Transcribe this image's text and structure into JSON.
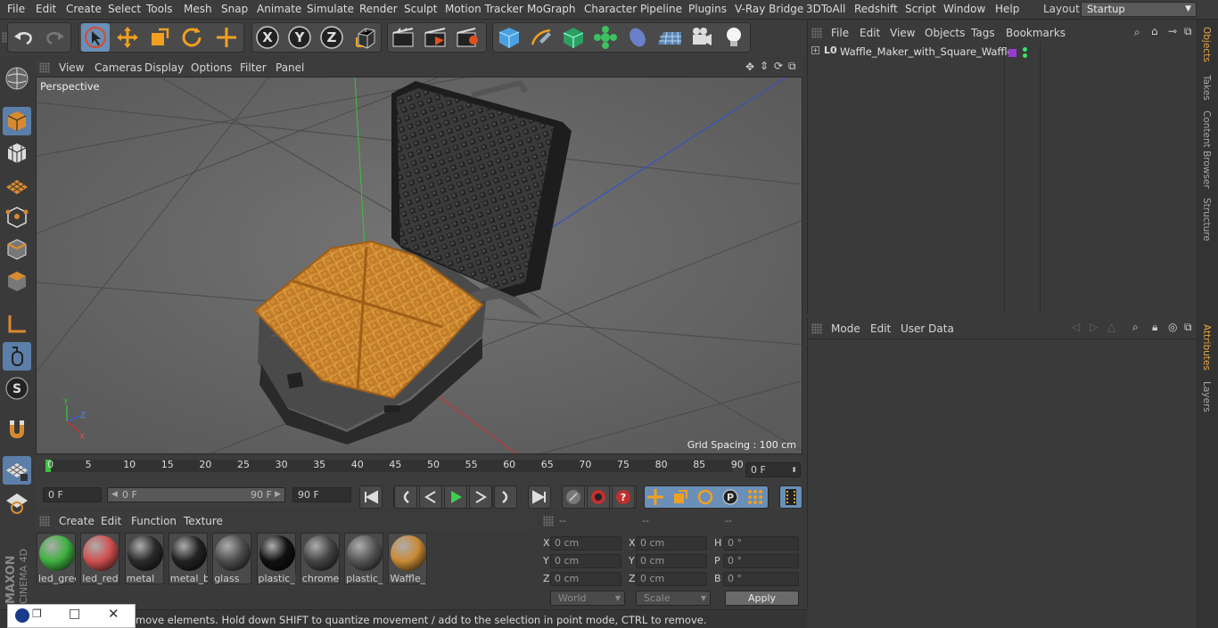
{
  "menubar": {
    "items": [
      "File",
      "Edit",
      "Create",
      "Select",
      "Tools",
      "Mesh",
      "Snap",
      "Animate",
      "Simulate",
      "Render",
      "Sculpt",
      "Motion Tracker",
      "MoGraph",
      "Character",
      "Pipeline",
      "Plugins",
      "V-Ray Bridge",
      "3DToAll",
      "Redshift",
      "Script",
      "Window",
      "Help"
    ],
    "layout_label": "Layout:",
    "layout_value": "Startup"
  },
  "viewport": {
    "menu": [
      "View",
      "Cameras",
      "Display",
      "Options",
      "Filter",
      "Panel"
    ],
    "label": "Perspective",
    "grid_spacing": "Grid Spacing : 100 cm"
  },
  "timeline": {
    "ticks": [
      "0",
      "5",
      "10",
      "15",
      "20",
      "25",
      "30",
      "35",
      "40",
      "45",
      "50",
      "55",
      "60",
      "65",
      "70",
      "75",
      "80",
      "85",
      "90"
    ],
    "current_frame": "0 F"
  },
  "transport": {
    "start_field": "0 F",
    "range_start": "0 F",
    "range_end": "90 F",
    "end_field": "90 F"
  },
  "materials": {
    "menu": [
      "Create",
      "Edit",
      "Function",
      "Texture"
    ],
    "items": [
      {
        "label": "led_green",
        "color": "#3fb040"
      },
      {
        "label": "led_red",
        "color": "#d05050"
      },
      {
        "label": "metal",
        "color": "#2a2a2a"
      },
      {
        "label": "metal_b",
        "color": "#222222"
      },
      {
        "label": "glass",
        "color": "#4d4d4d"
      },
      {
        "label": "plastic_b",
        "color": "#101010"
      },
      {
        "label": "chrome",
        "color": "#444444"
      },
      {
        "label": "plastic_c",
        "color": "#555555"
      },
      {
        "label": "Waffle_",
        "color": "#c98a35"
      }
    ]
  },
  "coordinates": {
    "headers": [
      "--",
      "--",
      "--"
    ],
    "rows": [
      {
        "a": "X",
        "av": "0 cm",
        "b": "X",
        "bv": "0 cm",
        "c": "H",
        "cv": "0 °"
      },
      {
        "a": "Y",
        "av": "0 cm",
        "b": "Y",
        "bv": "0 cm",
        "c": "P",
        "cv": "0 °"
      },
      {
        "a": "Z",
        "av": "0 cm",
        "b": "Z",
        "bv": "0 cm",
        "c": "B",
        "cv": "0 °"
      }
    ],
    "space": "World",
    "mode": "Scale",
    "apply": "Apply"
  },
  "objects": {
    "menu": [
      "File",
      "Edit",
      "View",
      "Objects",
      "Tags",
      "Bookmarks"
    ],
    "tree": [
      {
        "name": "Waffle_Maker_with_Square_Waffle"
      }
    ]
  },
  "attributes": {
    "menu": [
      "Mode",
      "Edit",
      "User Data"
    ]
  },
  "right_tabs": [
    "Objects",
    "Takes",
    "Content Browser",
    "Structure",
    "Attributes",
    "Layers"
  ],
  "status": {
    "text": "move elements. Hold down SHIFT to quantize movement / add to the selection in point mode, CTRL to remove."
  },
  "brand": {
    "line1": "MAXON",
    "line2": "CINEMA 4D"
  }
}
